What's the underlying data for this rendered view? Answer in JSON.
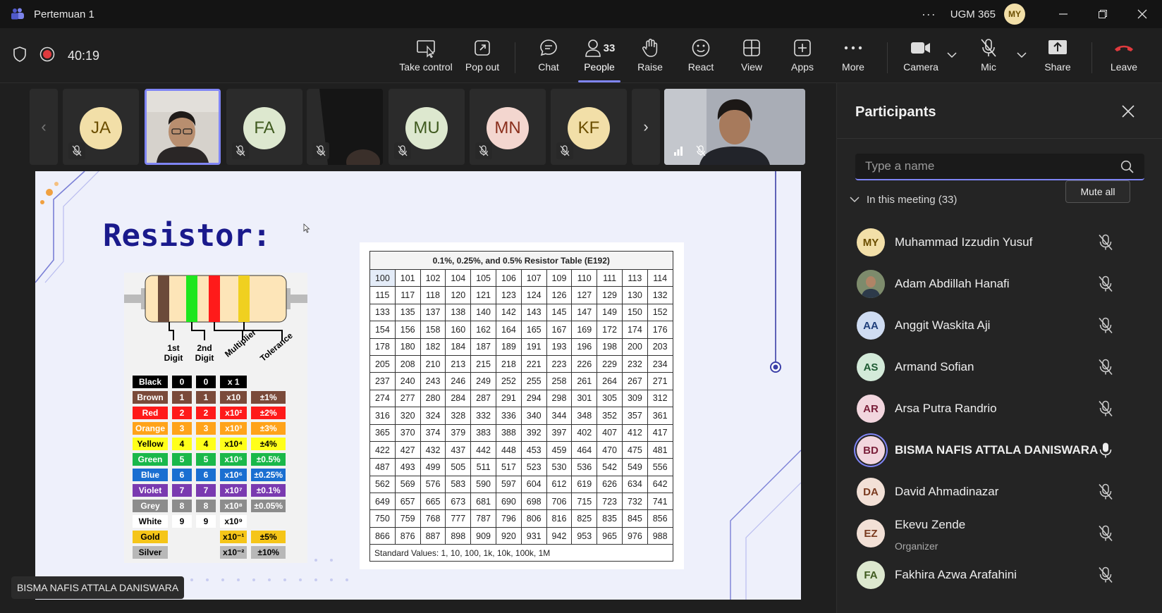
{
  "window": {
    "title": "Pertemuan 1",
    "org": "UGM 365",
    "user_initials": "MY"
  },
  "toolbar": {
    "timer": "40:19",
    "buttons": {
      "take_control": "Take control",
      "pop_out": "Pop out",
      "chat": "Chat",
      "people": "People",
      "people_count": "33",
      "raise": "Raise",
      "react": "React",
      "view": "View",
      "apps": "Apps",
      "more": "More",
      "camera": "Camera",
      "mic": "Mic",
      "share": "Share",
      "leave": "Leave"
    }
  },
  "video_strip": [
    {
      "initials": "JA",
      "bg": "#f2dfa8",
      "fg": "#6b4e00"
    },
    {
      "initials": "",
      "video": true
    },
    {
      "initials": "FA",
      "bg": "#dde8cf",
      "fg": "#3f5a1f"
    },
    {
      "initials": "",
      "video": true
    },
    {
      "initials": "MU",
      "bg": "#dde8cf",
      "fg": "#3f5a1f"
    },
    {
      "initials": "MN",
      "bg": "#f3d6cf",
      "fg": "#8a2f1d"
    },
    {
      "initials": "KF",
      "bg": "#f2dfa8",
      "fg": "#6b4e00"
    }
  ],
  "slide": {
    "title": "Resistor:",
    "presenter_name": "BISMA NAFIS ATTALA DANISWARA",
    "band_labels": [
      "1st Digit",
      "2nd Digit",
      "Multiplier",
      "Tolerance"
    ],
    "color_codes": [
      {
        "name": "Black",
        "d1": "0",
        "d2": "0",
        "mult": "x 1",
        "tol": "",
        "bg": "#000000",
        "fg": "#ffffff"
      },
      {
        "name": "Brown",
        "d1": "1",
        "d2": "1",
        "mult": "x10",
        "tol": "±1%",
        "bg": "#7a4a3a",
        "fg": "#ffffff"
      },
      {
        "name": "Red",
        "d1": "2",
        "d2": "2",
        "mult": "x10²",
        "tol": "±2%",
        "bg": "#ff1a1a",
        "fg": "#ffffff"
      },
      {
        "name": "Orange",
        "d1": "3",
        "d2": "3",
        "mult": "x10³",
        "tol": "±3%",
        "bg": "#ffa31a",
        "fg": "#ffffff"
      },
      {
        "name": "Yellow",
        "d1": "4",
        "d2": "4",
        "mult": "x10⁴",
        "tol": "±4%",
        "bg": "#ffff1a",
        "fg": "#000000"
      },
      {
        "name": "Green",
        "d1": "5",
        "d2": "5",
        "mult": "x10⁵",
        "tol": "±0.5%",
        "bg": "#1ab84a",
        "fg": "#ffffff"
      },
      {
        "name": "Blue",
        "d1": "6",
        "d2": "6",
        "mult": "x10⁶",
        "tol": "±0.25%",
        "bg": "#1a6fd1",
        "fg": "#ffffff"
      },
      {
        "name": "Violet",
        "d1": "7",
        "d2": "7",
        "mult": "x10⁷",
        "tol": "±0.1%",
        "bg": "#7a3ab0",
        "fg": "#ffffff"
      },
      {
        "name": "Grey",
        "d1": "8",
        "d2": "8",
        "mult": "x10⁸",
        "tol": "±0.05%",
        "bg": "#8c8c8c",
        "fg": "#ffffff"
      },
      {
        "name": "White",
        "d1": "9",
        "d2": "9",
        "mult": "x10⁹",
        "tol": "",
        "bg": "#ffffff",
        "fg": "#000000"
      },
      {
        "name": "Gold",
        "d1": "",
        "d2": "",
        "mult": "x10⁻¹",
        "tol": "±5%",
        "bg": "#f5c518",
        "fg": "#000000"
      },
      {
        "name": "Silver",
        "d1": "",
        "d2": "",
        "mult": "x10⁻²",
        "tol": "±10%",
        "bg": "#b8b8b8",
        "fg": "#000000"
      }
    ],
    "e192_title": "0.1%, 0.25%, and 0.5% Resistor Table (E192)",
    "e192_rows": [
      [
        "100",
        "101",
        "102",
        "104",
        "105",
        "106",
        "107",
        "109",
        "110",
        "111",
        "113",
        "114"
      ],
      [
        "115",
        "117",
        "118",
        "120",
        "121",
        "123",
        "124",
        "126",
        "127",
        "129",
        "130",
        "132"
      ],
      [
        "133",
        "135",
        "137",
        "138",
        "140",
        "142",
        "143",
        "145",
        "147",
        "149",
        "150",
        "152"
      ],
      [
        "154",
        "156",
        "158",
        "160",
        "162",
        "164",
        "165",
        "167",
        "169",
        "172",
        "174",
        "176"
      ],
      [
        "178",
        "180",
        "182",
        "184",
        "187",
        "189",
        "191",
        "193",
        "196",
        "198",
        "200",
        "203"
      ],
      [
        "205",
        "208",
        "210",
        "213",
        "215",
        "218",
        "221",
        "223",
        "226",
        "229",
        "232",
        "234"
      ],
      [
        "237",
        "240",
        "243",
        "246",
        "249",
        "252",
        "255",
        "258",
        "261",
        "264",
        "267",
        "271"
      ],
      [
        "274",
        "277",
        "280",
        "284",
        "287",
        "291",
        "294",
        "298",
        "301",
        "305",
        "309",
        "312"
      ],
      [
        "316",
        "320",
        "324",
        "328",
        "332",
        "336",
        "340",
        "344",
        "348",
        "352",
        "357",
        "361"
      ],
      [
        "365",
        "370",
        "374",
        "379",
        "383",
        "388",
        "392",
        "397",
        "402",
        "407",
        "412",
        "417"
      ],
      [
        "422",
        "427",
        "432",
        "437",
        "442",
        "448",
        "453",
        "459",
        "464",
        "470",
        "475",
        "481"
      ],
      [
        "487",
        "493",
        "499",
        "505",
        "511",
        "517",
        "523",
        "530",
        "536",
        "542",
        "549",
        "556"
      ],
      [
        "562",
        "569",
        "576",
        "583",
        "590",
        "597",
        "604",
        "612",
        "619",
        "626",
        "634",
        "642"
      ],
      [
        "649",
        "657",
        "665",
        "673",
        "681",
        "690",
        "698",
        "706",
        "715",
        "723",
        "732",
        "741"
      ],
      [
        "750",
        "759",
        "768",
        "777",
        "787",
        "796",
        "806",
        "816",
        "825",
        "835",
        "845",
        "856"
      ],
      [
        "866",
        "876",
        "887",
        "898",
        "909",
        "920",
        "931",
        "942",
        "953",
        "965",
        "976",
        "988"
      ]
    ],
    "e192_footer": "Standard Values: 1, 10, 100, 1k, 10k, 100k, 1M"
  },
  "participants_panel": {
    "title": "Participants",
    "search_placeholder": "Type a name",
    "in_meeting_label": "In this meeting (33)",
    "mute_all": "Mute all",
    "people": [
      {
        "initials": "MY",
        "name": "Muhammad Izzudin Yusuf",
        "sub": "",
        "bg": "#f2dfa8",
        "fg": "#6b4e00",
        "mic": "muted"
      },
      {
        "initials": "",
        "name": "Adam Abdillah Hanafi",
        "sub": "",
        "bg": "#6b7a5a",
        "fg": "#fff",
        "mic": "muted",
        "photo": true
      },
      {
        "initials": "AA",
        "name": "Anggit Waskita Aji",
        "sub": "",
        "bg": "#cfdcf2",
        "fg": "#1f3e7a",
        "mic": "muted"
      },
      {
        "initials": "AS",
        "name": "Armand Sofian",
        "sub": "",
        "bg": "#d3ead9",
        "fg": "#1d5a32",
        "mic": "muted"
      },
      {
        "initials": "AR",
        "name": "Arsa Putra Randrio",
        "sub": "",
        "bg": "#f2d6de",
        "fg": "#7a1f3a",
        "mic": "muted"
      },
      {
        "initials": "BD",
        "name": "BISMA NAFIS ATTALA DANISWARA",
        "sub": "",
        "bg": "#f2d6de",
        "fg": "#7a1f3a",
        "mic": "on",
        "speaking": true
      },
      {
        "initials": "DA",
        "name": "David Ahmadinazar",
        "sub": "",
        "bg": "#f2e0d6",
        "fg": "#7a3a1f",
        "mic": "muted"
      },
      {
        "initials": "EZ",
        "name": "Ekevu Zende",
        "sub": "Organizer",
        "bg": "#f2e0d6",
        "fg": "#7a3a1f",
        "mic": "muted"
      },
      {
        "initials": "FA",
        "name": "Fakhira Azwa Arafahini",
        "sub": "",
        "bg": "#dde8cf",
        "fg": "#3f5a1f",
        "mic": "muted"
      }
    ]
  }
}
